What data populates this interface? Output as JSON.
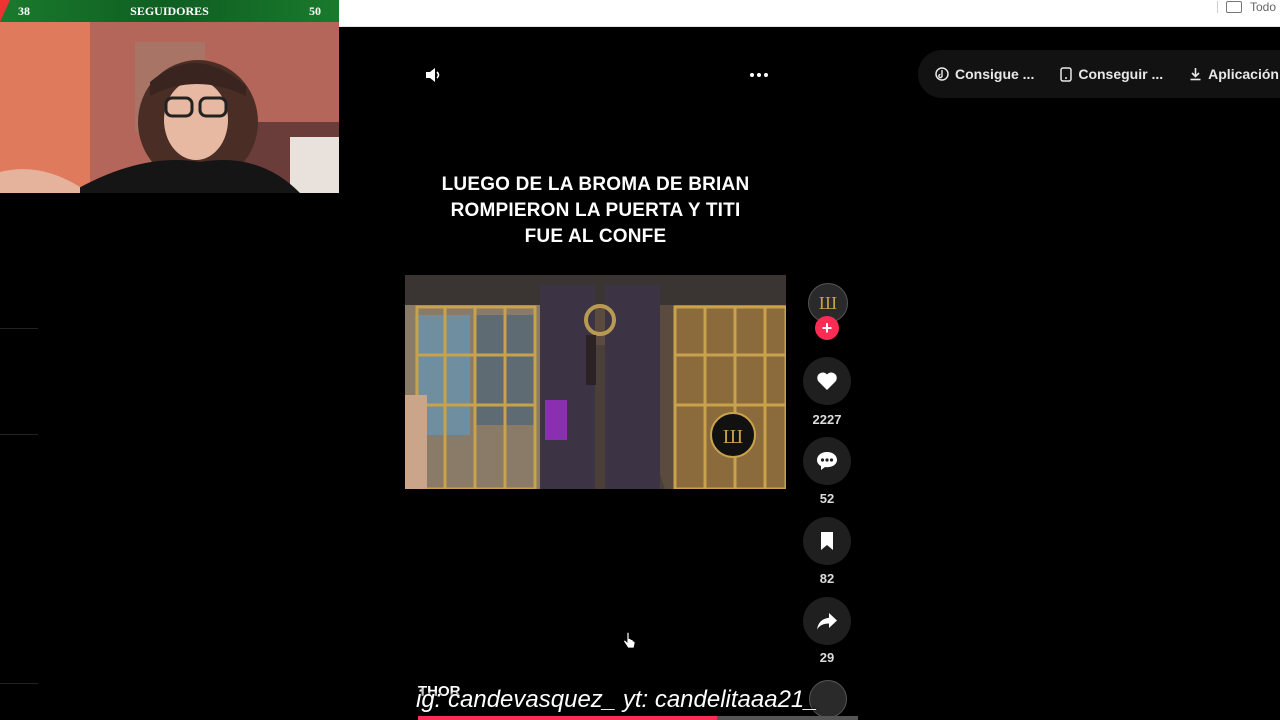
{
  "browser": {
    "bookmark_label": "Todo"
  },
  "stream_overlay": {
    "left_count": "38",
    "title": "SEGUIDORES",
    "right_count": "50"
  },
  "video": {
    "caption_lines": [
      "LUEGO DE LA BROMA DE BRIAN",
      "ROMPIERON LA PUERTA Y TITI",
      "FUE AL CONFE"
    ],
    "author": "THOR",
    "progress": 0.68
  },
  "actions": {
    "likes": "2227",
    "comments": "52",
    "saves": "82",
    "shares": "29"
  },
  "top_menu": {
    "items": [
      {
        "label": "Consigue ...",
        "icon": "tiktok-coin-icon"
      },
      {
        "label": "Conseguir ...",
        "icon": "phone-icon"
      },
      {
        "label": "Aplicación ...",
        "icon": "download-icon"
      }
    ]
  },
  "watermark": {
    "text": "ig: candevasquez_  yt: candelitaaa21_"
  },
  "colors": {
    "accent": "#fe2c55",
    "overlay_green": "#1a7a2c",
    "background": "#000000"
  }
}
